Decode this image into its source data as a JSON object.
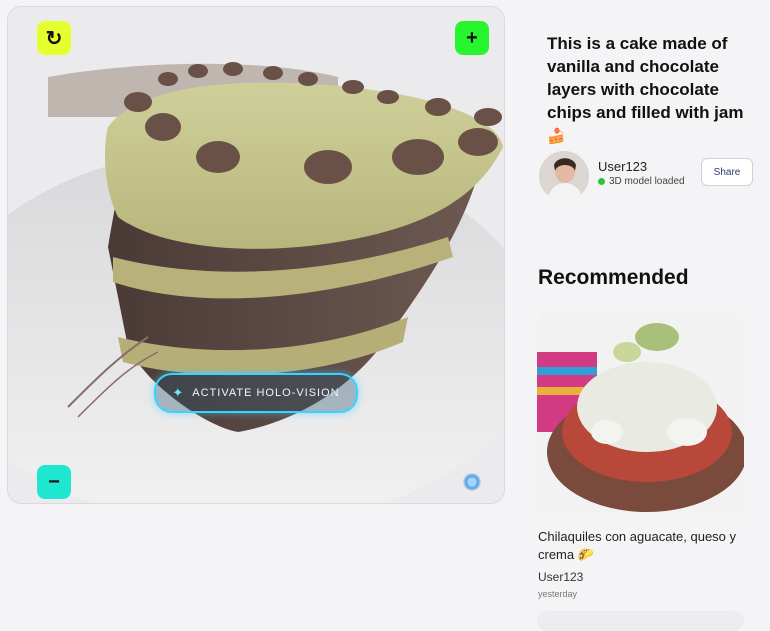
{
  "viewer": {
    "holo_label": "ACTIVATE HOLO-VISION",
    "rotate_icon": "↻",
    "zoom_in_icon": "+",
    "zoom_out_icon": "−"
  },
  "post": {
    "title": "This is a cake made of vanilla and chocolate layers with chocolate chips and filled with jam",
    "title_emoji": "🍰",
    "user": "User123",
    "status": "3D model loaded",
    "share_label": "Share"
  },
  "recommended": {
    "heading": "Recommended",
    "items": [
      {
        "title": "Chilaquiles con aguacate, queso y crema",
        "emoji": "🌮",
        "user": "User123",
        "time": "yesterday"
      }
    ]
  },
  "colors": {
    "rotate": "#e5ff2e",
    "zoom_in": "#29f52f",
    "zoom_out": "#1fe6d0",
    "holo_border": "#39d3ff",
    "status_dot": "#2ec43a"
  }
}
